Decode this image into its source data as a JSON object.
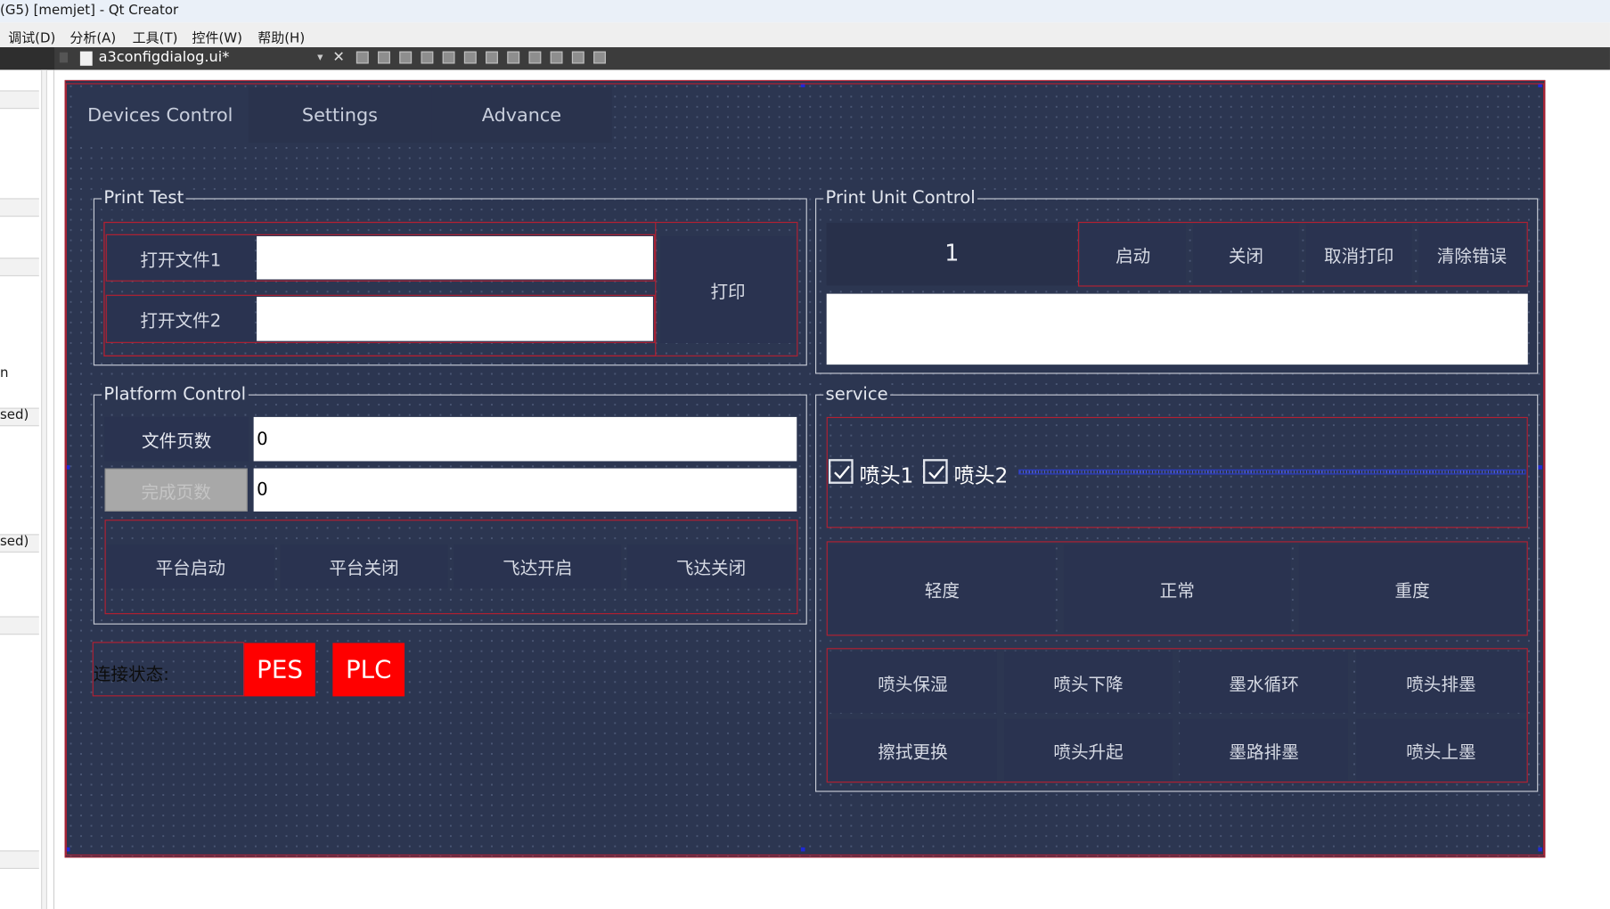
{
  "window": {
    "title": "(G5) [memjet] - Qt Creator"
  },
  "menu": [
    "调试(D)",
    "分析(A)",
    "工具(T)",
    "控件(W)",
    "帮助(H)"
  ],
  "editor": {
    "file_tab": "a3configdialog.ui*"
  },
  "left_panel": {
    "fragments": [
      "n",
      "sed)",
      "sed)"
    ]
  },
  "tabs": [
    "Devices Control",
    "Settings",
    "Advance"
  ],
  "print_test": {
    "title": "Print Test",
    "open_file1": "打开文件1",
    "open_file2": "打开文件2",
    "file1_value": "",
    "file2_value": "",
    "print": "打印"
  },
  "print_unit": {
    "title": "Print Unit Control",
    "unit_value": "1",
    "buttons": [
      "启动",
      "关闭",
      "取消打印",
      "清除错误"
    ],
    "log": ""
  },
  "platform": {
    "title": "Platform Control",
    "file_pages_label": "文件页数",
    "file_pages_value": "0",
    "done_pages_label": "完成页数",
    "done_pages_value": "0",
    "buttons": [
      "平台启动",
      "平台关闭",
      "飞达开启",
      "飞达关闭"
    ]
  },
  "service": {
    "title": "service",
    "head1": "喷头1",
    "head2": "喷头2",
    "head1_checked": true,
    "head2_checked": true,
    "levels": [
      "轻度",
      "正常",
      "重度"
    ],
    "actions_row1": [
      "喷头保湿",
      "喷头下降",
      "墨水循环",
      "喷头排墨"
    ],
    "actions_row2": [
      "擦拭更换",
      "喷头升起",
      "墨路排墨",
      "喷头上墨"
    ]
  },
  "connection": {
    "label": "连接状态:",
    "pes": "PES",
    "plc": "PLC",
    "status_color": "#ff0000"
  }
}
